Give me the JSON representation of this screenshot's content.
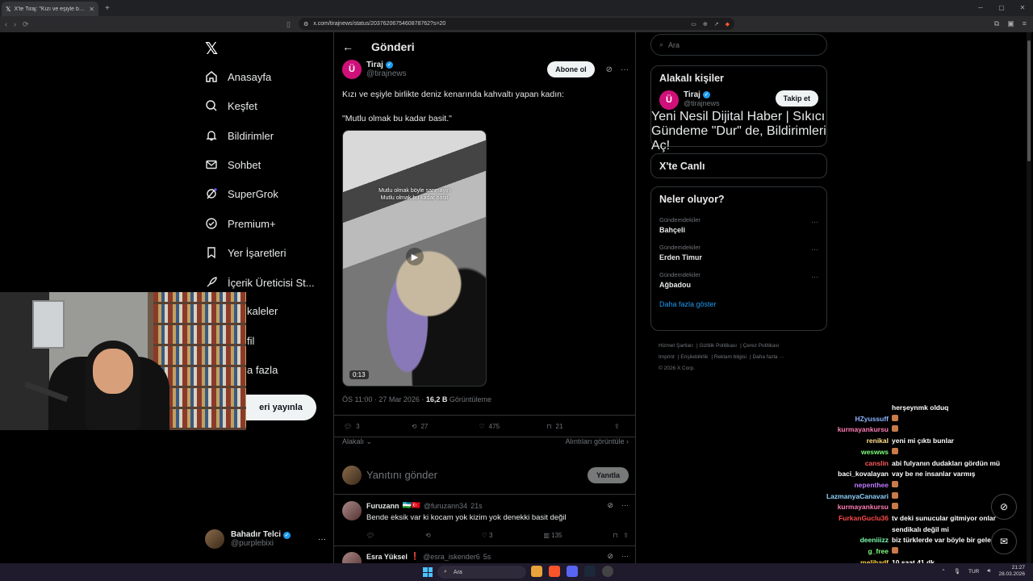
{
  "browser": {
    "tab_title": "X'te Tiraj: \"Kızı ve eşiyle birlikte d",
    "url": "x.com/tirajnews/status/2037620675460878762?s=20"
  },
  "left_nav": {
    "items": [
      {
        "label": "Anasayfa",
        "icon": "home-icon"
      },
      {
        "label": "Keşfet",
        "icon": "search-icon"
      },
      {
        "label": "Bildirimler",
        "icon": "bell-icon"
      },
      {
        "label": "Sohbet",
        "icon": "mail-icon"
      },
      {
        "label": "SuperGrok",
        "icon": "grok-icon"
      },
      {
        "label": "Premium+",
        "icon": "premium-icon"
      },
      {
        "label": "Yer İşaretleri",
        "icon": "bookmark-icon"
      },
      {
        "label": "İçerik Üreticisi St...",
        "icon": "rocket-icon"
      },
      {
        "label": "kaleler",
        "icon": "article-icon"
      },
      {
        "label": "fil",
        "icon": "profile-icon"
      },
      {
        "label": "a fazla",
        "icon": "more-icon"
      }
    ],
    "post_button": "eri yayınla",
    "account": {
      "name": "Bahadır Telci",
      "handle": "@purplebixi"
    }
  },
  "main": {
    "header_title": "Gönderi",
    "author": {
      "name": "Tiraj",
      "handle": "@tirajnews",
      "avatar_letter": "Ü"
    },
    "follow_label": "Abone ol",
    "text_line1": "Kızı ve eşiyle birlikte deniz kenarında kahvaltı yapan kadın:",
    "text_line2": "\"Mutlu olmak bu kadar basit.\"",
    "video": {
      "caption": "Mutlu olmak böyle sanmayın\nMutlu olmak bu kadar basit",
      "duration": "0:13"
    },
    "meta_time": "ÖS 11:00 · 27 Mar 2026 · ",
    "meta_views": "16,2 B",
    "meta_views_label": " Görüntüleme",
    "stats": {
      "replies": "3",
      "reposts": "27",
      "likes": "475",
      "bookmarks": "21"
    },
    "related_label": "Alakalı",
    "quotes_label": "Alıntıları görüntüle",
    "reply_placeholder": "Yanıtını gönder",
    "reply_button": "Yanıtla",
    "replies": [
      {
        "user": "Furuzann",
        "handle": "@furuzann34",
        "time": "21s",
        "text": "Bende eksik var ki kocam yok kizim yok denekki basit değil",
        "replies": "",
        "reposts": "",
        "likes": "3",
        "views": "135"
      },
      {
        "user": "Esra Yüksel",
        "handle": "@esra_iskender6",
        "time": "5s",
        "text": "",
        "replies": "",
        "reposts": "",
        "likes": "",
        "views": ""
      }
    ]
  },
  "right": {
    "search_placeholder": "Ara",
    "related_people_title": "Alakalı kişiler",
    "person": {
      "name": "Tiraj",
      "handle": "@tirajnews",
      "bio": "Yeni Nesil Dijital Haber | Sıkıcı Gündeme \"Dur\" de, Bildirimleri Aç!",
      "button": "Takip et"
    },
    "live_title": "X'te Canlı",
    "trends_title": "Neler oluyor?",
    "trends": [
      {
        "category": "Gündemdekiler",
        "topic": "Bahçeli"
      },
      {
        "category": "Gündemdekiler",
        "topic": "Erden Timur"
      },
      {
        "category": "Gündemdekiler",
        "topic": "Ağbadou"
      }
    ],
    "show_more": "Daha fazla göster",
    "footer": [
      "Hizmet Şartları",
      "Gizlilik Politikası",
      "Çerez Politikası",
      "Imprint",
      "Erişilebilirlik",
      "Reklam bilgisi",
      "Daha fazla ···",
      "© 2026 X Corp."
    ]
  },
  "chat": [
    {
      "user": "",
      "msg": "herşeynmk olduq",
      "color": "#ffffff"
    },
    {
      "user": "HZyussuff",
      "msg": "",
      "color": "#8fb4ff",
      "emote": true
    },
    {
      "user": "kurmayankursu",
      "msg": "",
      "color": "#ff7eb6",
      "emote": true
    },
    {
      "user": "renikal",
      "msg": "yeni mi çıktı bunlar",
      "color": "#ffe08a"
    },
    {
      "user": "weswws",
      "msg": "",
      "color": "#7dff7d",
      "emote": true
    },
    {
      "user": "canslin",
      "msg": "abi fulyanın dudakları gördün mü",
      "color": "#ff5a5a"
    },
    {
      "user": "baci_kovalayan",
      "msg": "vay be ne insanlar varmış",
      "color": "#ffffff"
    },
    {
      "user": "nepenthee",
      "msg": "",
      "color": "#c07aff",
      "emote": true
    },
    {
      "user": "LazmanyaCanavari",
      "msg": "",
      "color": "#8fd4ff",
      "emote": true
    },
    {
      "user": "kurmayankursu",
      "msg": "",
      "color": "#ff7eb6",
      "emote": true
    },
    {
      "user": "FurkanGuclu36",
      "msg": "tv deki sunucular gitmiyor onlar",
      "color": "#ff4a4a"
    },
    {
      "user": "",
      "msg": "sendikalı değil mi",
      "color": "#ffffff"
    },
    {
      "user": "deeniiizz",
      "msg": "biz türklerde var böyle bir gelenek",
      "color": "#7dffb0"
    },
    {
      "user": "g_free",
      "msg": "",
      "color": "#7dff7d",
      "emote": true
    },
    {
      "user": "melihadf",
      "msg": "10 saat 41 dk",
      "color": "#ffd24a"
    },
    {
      "user": "HZyussuff",
      "msg": "",
      "color": "#8fb4ff"
    }
  ],
  "taskbar": {
    "search": "Ara",
    "lang": "TUR",
    "time": "21:27",
    "date": "28.03.2026"
  }
}
